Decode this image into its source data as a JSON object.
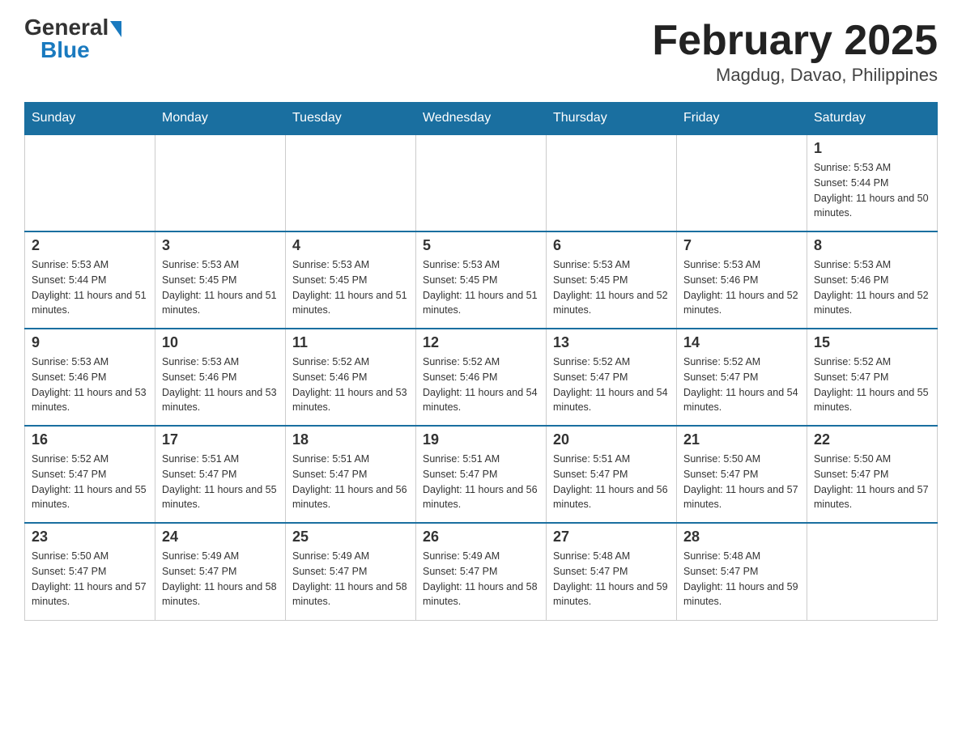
{
  "logo": {
    "general": "General",
    "blue": "Blue"
  },
  "title": "February 2025",
  "location": "Magdug, Davao, Philippines",
  "days_of_week": [
    "Sunday",
    "Monday",
    "Tuesday",
    "Wednesday",
    "Thursday",
    "Friday",
    "Saturday"
  ],
  "weeks": [
    [
      null,
      null,
      null,
      null,
      null,
      null,
      {
        "day": "1",
        "sunrise": "Sunrise: 5:53 AM",
        "sunset": "Sunset: 5:44 PM",
        "daylight": "Daylight: 11 hours and 50 minutes."
      }
    ],
    [
      {
        "day": "2",
        "sunrise": "Sunrise: 5:53 AM",
        "sunset": "Sunset: 5:44 PM",
        "daylight": "Daylight: 11 hours and 51 minutes."
      },
      {
        "day": "3",
        "sunrise": "Sunrise: 5:53 AM",
        "sunset": "Sunset: 5:45 PM",
        "daylight": "Daylight: 11 hours and 51 minutes."
      },
      {
        "day": "4",
        "sunrise": "Sunrise: 5:53 AM",
        "sunset": "Sunset: 5:45 PM",
        "daylight": "Daylight: 11 hours and 51 minutes."
      },
      {
        "day": "5",
        "sunrise": "Sunrise: 5:53 AM",
        "sunset": "Sunset: 5:45 PM",
        "daylight": "Daylight: 11 hours and 51 minutes."
      },
      {
        "day": "6",
        "sunrise": "Sunrise: 5:53 AM",
        "sunset": "Sunset: 5:45 PM",
        "daylight": "Daylight: 11 hours and 52 minutes."
      },
      {
        "day": "7",
        "sunrise": "Sunrise: 5:53 AM",
        "sunset": "Sunset: 5:46 PM",
        "daylight": "Daylight: 11 hours and 52 minutes."
      },
      {
        "day": "8",
        "sunrise": "Sunrise: 5:53 AM",
        "sunset": "Sunset: 5:46 PM",
        "daylight": "Daylight: 11 hours and 52 minutes."
      }
    ],
    [
      {
        "day": "9",
        "sunrise": "Sunrise: 5:53 AM",
        "sunset": "Sunset: 5:46 PM",
        "daylight": "Daylight: 11 hours and 53 minutes."
      },
      {
        "day": "10",
        "sunrise": "Sunrise: 5:53 AM",
        "sunset": "Sunset: 5:46 PM",
        "daylight": "Daylight: 11 hours and 53 minutes."
      },
      {
        "day": "11",
        "sunrise": "Sunrise: 5:52 AM",
        "sunset": "Sunset: 5:46 PM",
        "daylight": "Daylight: 11 hours and 53 minutes."
      },
      {
        "day": "12",
        "sunrise": "Sunrise: 5:52 AM",
        "sunset": "Sunset: 5:46 PM",
        "daylight": "Daylight: 11 hours and 54 minutes."
      },
      {
        "day": "13",
        "sunrise": "Sunrise: 5:52 AM",
        "sunset": "Sunset: 5:47 PM",
        "daylight": "Daylight: 11 hours and 54 minutes."
      },
      {
        "day": "14",
        "sunrise": "Sunrise: 5:52 AM",
        "sunset": "Sunset: 5:47 PM",
        "daylight": "Daylight: 11 hours and 54 minutes."
      },
      {
        "day": "15",
        "sunrise": "Sunrise: 5:52 AM",
        "sunset": "Sunset: 5:47 PM",
        "daylight": "Daylight: 11 hours and 55 minutes."
      }
    ],
    [
      {
        "day": "16",
        "sunrise": "Sunrise: 5:52 AM",
        "sunset": "Sunset: 5:47 PM",
        "daylight": "Daylight: 11 hours and 55 minutes."
      },
      {
        "day": "17",
        "sunrise": "Sunrise: 5:51 AM",
        "sunset": "Sunset: 5:47 PM",
        "daylight": "Daylight: 11 hours and 55 minutes."
      },
      {
        "day": "18",
        "sunrise": "Sunrise: 5:51 AM",
        "sunset": "Sunset: 5:47 PM",
        "daylight": "Daylight: 11 hours and 56 minutes."
      },
      {
        "day": "19",
        "sunrise": "Sunrise: 5:51 AM",
        "sunset": "Sunset: 5:47 PM",
        "daylight": "Daylight: 11 hours and 56 minutes."
      },
      {
        "day": "20",
        "sunrise": "Sunrise: 5:51 AM",
        "sunset": "Sunset: 5:47 PM",
        "daylight": "Daylight: 11 hours and 56 minutes."
      },
      {
        "day": "21",
        "sunrise": "Sunrise: 5:50 AM",
        "sunset": "Sunset: 5:47 PM",
        "daylight": "Daylight: 11 hours and 57 minutes."
      },
      {
        "day": "22",
        "sunrise": "Sunrise: 5:50 AM",
        "sunset": "Sunset: 5:47 PM",
        "daylight": "Daylight: 11 hours and 57 minutes."
      }
    ],
    [
      {
        "day": "23",
        "sunrise": "Sunrise: 5:50 AM",
        "sunset": "Sunset: 5:47 PM",
        "daylight": "Daylight: 11 hours and 57 minutes."
      },
      {
        "day": "24",
        "sunrise": "Sunrise: 5:49 AM",
        "sunset": "Sunset: 5:47 PM",
        "daylight": "Daylight: 11 hours and 58 minutes."
      },
      {
        "day": "25",
        "sunrise": "Sunrise: 5:49 AM",
        "sunset": "Sunset: 5:47 PM",
        "daylight": "Daylight: 11 hours and 58 minutes."
      },
      {
        "day": "26",
        "sunrise": "Sunrise: 5:49 AM",
        "sunset": "Sunset: 5:47 PM",
        "daylight": "Daylight: 11 hours and 58 minutes."
      },
      {
        "day": "27",
        "sunrise": "Sunrise: 5:48 AM",
        "sunset": "Sunset: 5:47 PM",
        "daylight": "Daylight: 11 hours and 59 minutes."
      },
      {
        "day": "28",
        "sunrise": "Sunrise: 5:48 AM",
        "sunset": "Sunset: 5:47 PM",
        "daylight": "Daylight: 11 hours and 59 minutes."
      },
      null
    ]
  ]
}
